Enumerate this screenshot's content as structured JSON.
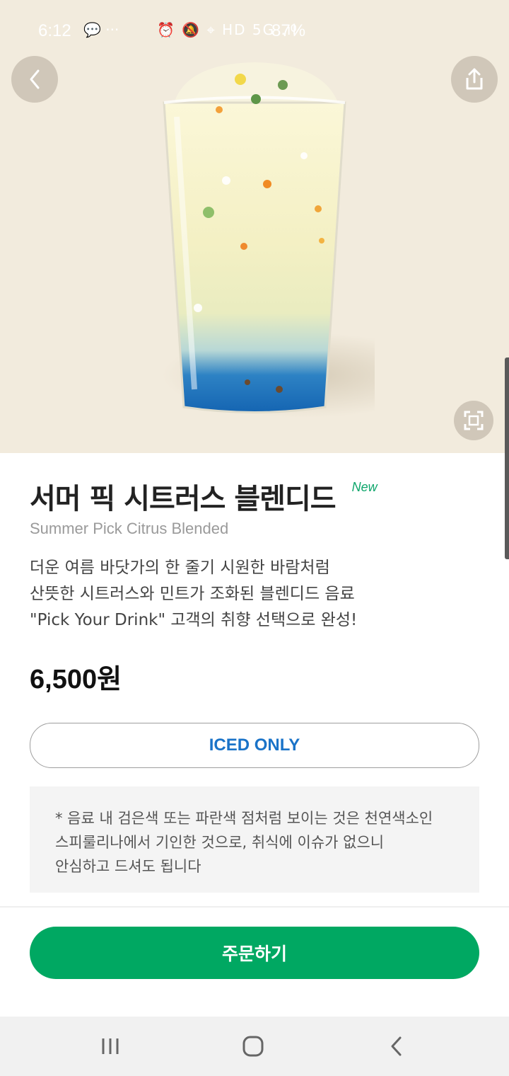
{
  "status_bar": {
    "time": "6:12",
    "notification_icons": "💬 ···",
    "system_icons": "⏰ 🔕 ⌖ HD 5G .ıl",
    "battery": "87%"
  },
  "product": {
    "name_ko": "서머 픽 시트러스 블렌디드",
    "badge": "New",
    "name_en": "Summer Pick Citrus Blended",
    "description_lines": [
      "더운 여름 바닷가의 한 줄기 시원한 바람처럼",
      "산뜻한 시트러스와 민트가 조화된 블렌디드 음료",
      "\"Pick Your Drink\" 고객의 취향 선택으로 완성!"
    ],
    "price": "6,500원",
    "temperature_option": "ICED ONLY",
    "notice_lines": [
      "* 음료 내 검은색 또는 파란색 점처럼 보이는 것은 천연색소인",
      "스피룰리나에서 기인한 것으로, 취식에 이슈가 없으니",
      "안심하고 드셔도 됩니다"
    ]
  },
  "actions": {
    "order_label": "주문하기"
  },
  "icons": {
    "back": "chevron-left-icon",
    "share": "share-icon",
    "fullscreen": "fullscreen-icon",
    "nav_recent": "recent-apps-icon",
    "nav_home": "home-icon",
    "nav_back": "back-icon"
  },
  "colors": {
    "hero_background": "#f2ebdd",
    "brand_green": "#00a862",
    "badge_green": "#0ea66b",
    "iced_blue": "#1a73c8"
  }
}
